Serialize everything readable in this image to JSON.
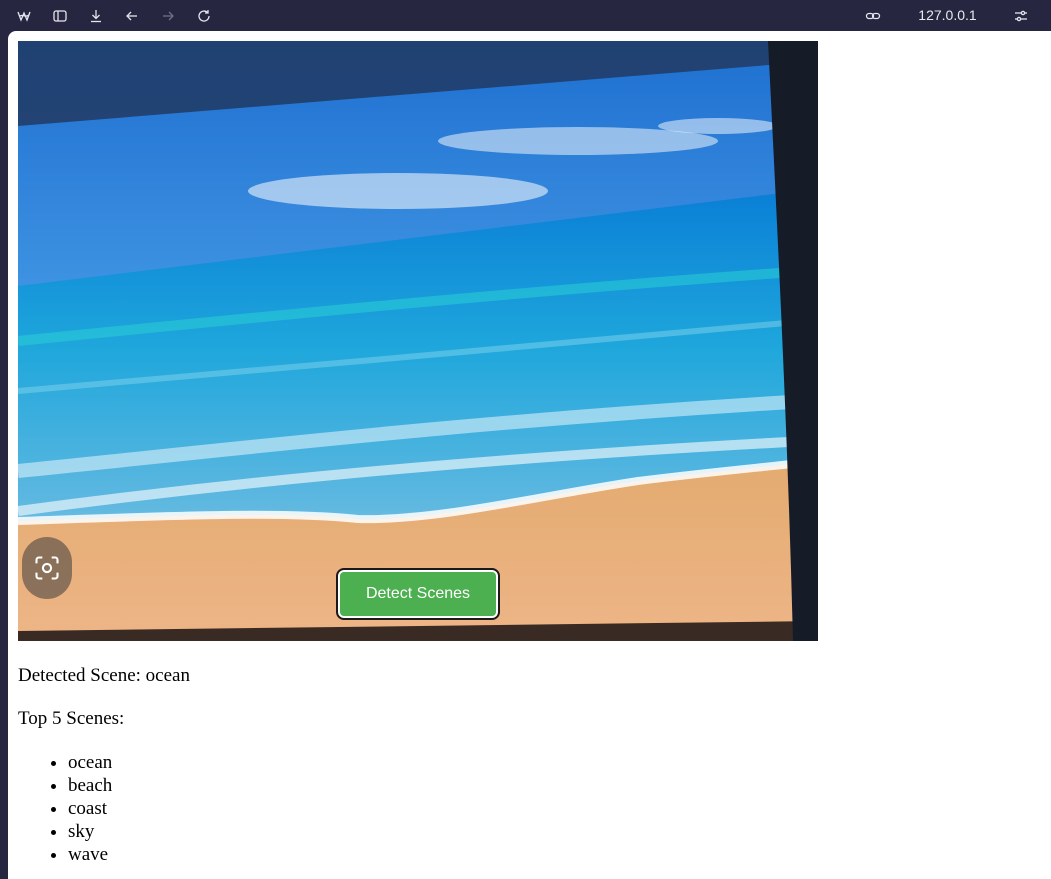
{
  "browser": {
    "url": "127.0.0.1",
    "icons": [
      "app-logo-icon",
      "sidebar-icon",
      "download-icon",
      "back-icon",
      "forward-icon",
      "reload-icon",
      "link-icon",
      "site-settings-icon"
    ]
  },
  "video": {
    "button_label": "Detect Scenes",
    "button_color": "#4caf50",
    "lens_icon": "camera-lens-icon"
  },
  "result": {
    "detected_label": "Detected Scene:",
    "detected_value": "ocean",
    "top_label": "Top 5 Scenes:",
    "scenes": [
      "ocean",
      "beach",
      "coast",
      "sky",
      "wave"
    ]
  }
}
